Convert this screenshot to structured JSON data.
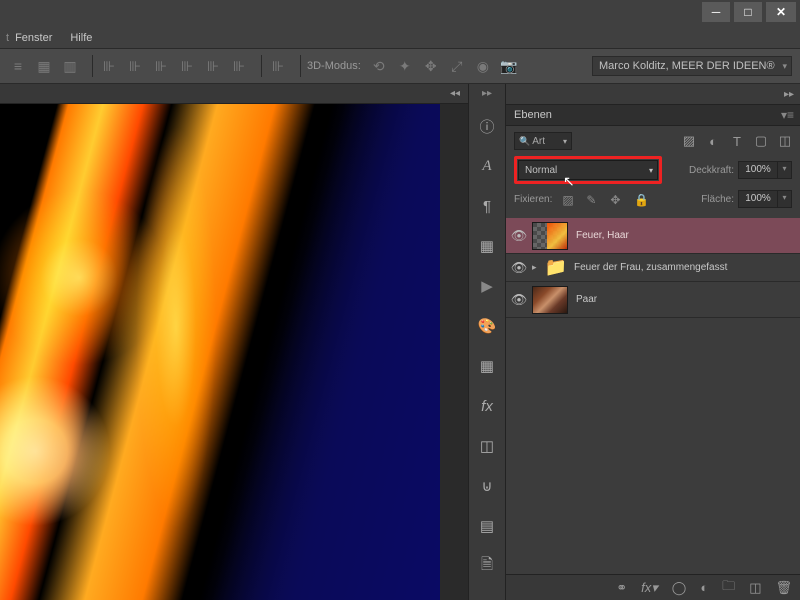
{
  "menu": {
    "fenster": "Fenster",
    "hilfe": "Hilfe"
  },
  "options": {
    "mode3d": "3D-Modus:",
    "credit": "Marco Kolditz, MEER DER IDEEN®"
  },
  "panel": {
    "title": "Ebenen",
    "filter_label": "Art",
    "blend_mode": "Normal",
    "opacity_label": "Deckkraft:",
    "opacity_value": "100%",
    "fill_label": "Fläche:",
    "fill_value": "100%",
    "lock_label": "Fixieren:"
  },
  "layers": [
    {
      "name": "Feuer, Haar"
    },
    {
      "name": "Feuer der Frau, zusammengefasst"
    },
    {
      "name": "Paar"
    }
  ]
}
